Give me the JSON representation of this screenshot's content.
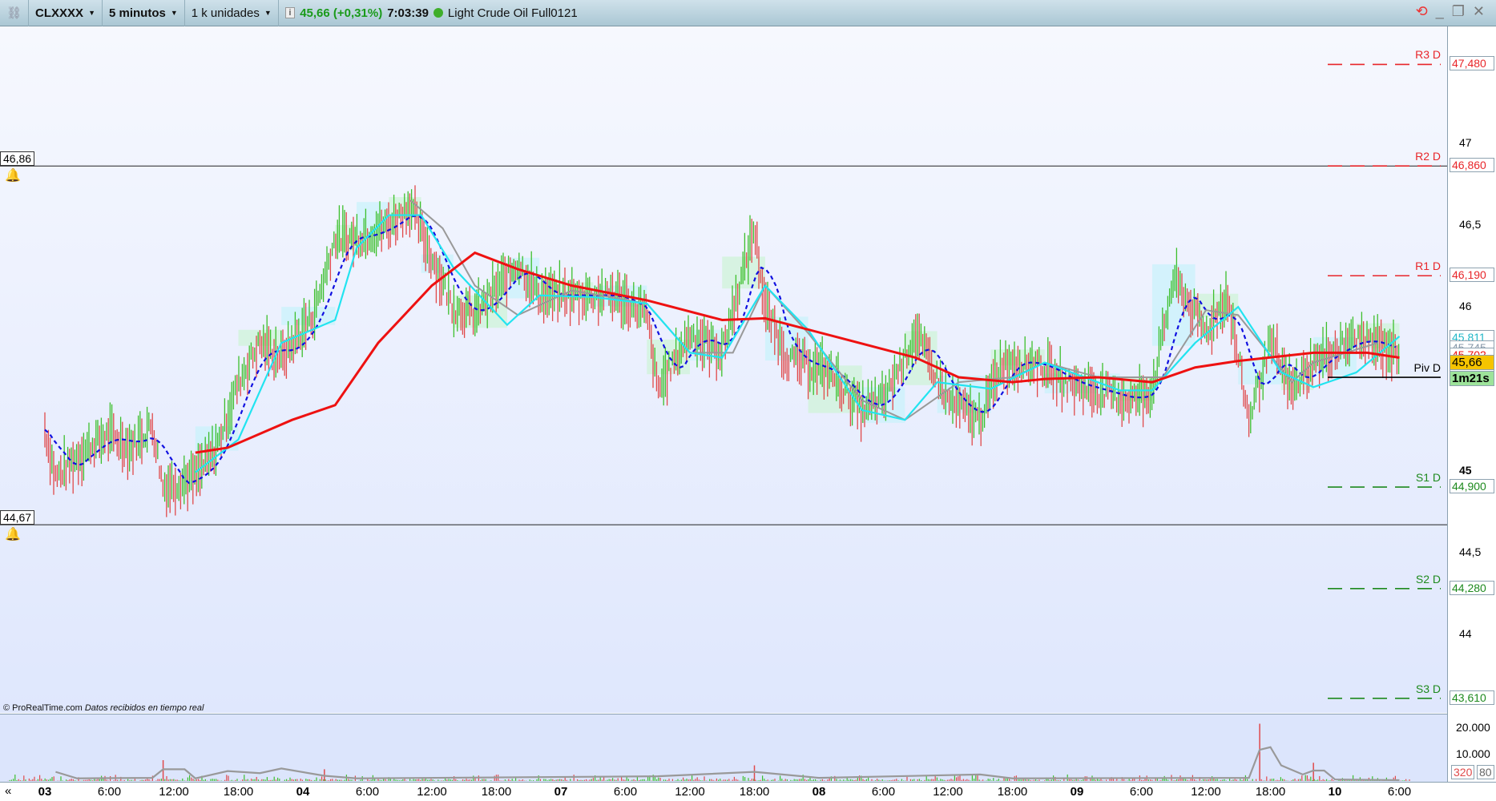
{
  "toolbar": {
    "symbol": "CLXXXX",
    "timeframe": "5 minutos",
    "units": "1 k unidades",
    "price_change": "45,66 (+0,31%)",
    "time": "7:03:39",
    "instrument": "Light Crude Oil Full0121",
    "info_icon": "info-icon",
    "refresh_icon": "refresh-arrows-icon"
  },
  "colors": {
    "up": "#3cbf2c",
    "down": "#e0494a",
    "ma_red": "#ee1111",
    "ma_cyan": "#22e4f0",
    "ma_blue": "#1010e0",
    "ma_gray": "#999999",
    "resistance": "#e8262a",
    "support": "#1e8a1e",
    "cloud_cyan": "#c8f2fb",
    "cloud_green": "#cdf3d6"
  },
  "footer": {
    "copyright": "© ProRealTime.com",
    "realtime": "Datos recibidos en tiempo real"
  },
  "hlines": [
    {
      "label": "46,86",
      "value": 46.86
    },
    {
      "label": "44,67",
      "value": 44.67
    }
  ],
  "levels": [
    {
      "name": "R3 D",
      "label": "47,480",
      "value": 47.48,
      "kind": "resistance"
    },
    {
      "name": "R2 D",
      "label": "46,860",
      "value": 46.86,
      "kind": "resistance"
    },
    {
      "name": "R1 D",
      "label": "46,190",
      "value": 46.19,
      "kind": "resistance"
    },
    {
      "name": "Piv D",
      "label": "45,570",
      "value": 45.57,
      "kind": "pivot"
    },
    {
      "name": "S1 D",
      "label": "44,900",
      "value": 44.9,
      "kind": "support"
    },
    {
      "name": "S2 D",
      "label": "44,280",
      "value": 44.28,
      "kind": "support"
    },
    {
      "name": "S3 D",
      "label": "43,610",
      "value": 43.61,
      "kind": "support"
    }
  ],
  "axis_ticks": [
    {
      "label": "47",
      "value": 47
    },
    {
      "label": "46,5",
      "value": 46.5
    },
    {
      "label": "46",
      "value": 46
    },
    {
      "label": "45",
      "value": 45,
      "bold": true
    },
    {
      "label": "44,5",
      "value": 44.5
    },
    {
      "label": "44",
      "value": 44
    }
  ],
  "indicator_labels": [
    {
      "label": "45,811",
      "value": 45.811,
      "color": "#22b8c8"
    },
    {
      "label": "45,745",
      "value": 45.745,
      "color": "#8899aa"
    },
    {
      "label": "45,702",
      "value": 45.702,
      "color": "#ee1111"
    }
  ],
  "last_price": {
    "label": "45,66",
    "value": 45.66
  },
  "countdown": "1m21s",
  "volume_axis": [
    {
      "label": "20.000",
      "value": 20000
    },
    {
      "label": "10.000",
      "value": 10000
    }
  ],
  "volume_last": {
    "a": "320",
    "b": "80"
  },
  "chart_data": {
    "type": "line",
    "time_labels": [
      "03",
      "6:00",
      "12:00",
      "18:00",
      "04",
      "6:00",
      "12:00",
      "18:00",
      "07",
      "6:00",
      "12:00",
      "18:00",
      "08",
      "6:00",
      "12:00",
      "18:00",
      "09",
      "6:00",
      "12:00",
      "18:00",
      "10",
      "6:00"
    ],
    "bold_labels": [
      "03",
      "04",
      "07",
      "08",
      "09",
      "10"
    ],
    "ylim": [
      43.45,
      47.7
    ],
    "series": [
      {
        "id": "price",
        "style": "bars",
        "points": [
          [
            "03 00:00",
            45.25
          ],
          [
            "03 01:00",
            44.96
          ],
          [
            "03 04:00",
            45.14
          ],
          [
            "03 06:00",
            45.22
          ],
          [
            "03 08:00",
            45.14
          ],
          [
            "03 10:00",
            45.28
          ],
          [
            "03 11:00",
            44.9
          ],
          [
            "03 14:00",
            44.96
          ],
          [
            "03 16:00",
            45.14
          ],
          [
            "03 18:00",
            45.54
          ],
          [
            "03 20:00",
            45.78
          ],
          [
            "03 22:00",
            45.69
          ],
          [
            "04 01:00",
            45.95
          ],
          [
            "04 03:00",
            46.42
          ],
          [
            "04 05:00",
            46.42
          ],
          [
            "04 08:00",
            46.5
          ],
          [
            "04 10:00",
            46.62
          ],
          [
            "04 12:00",
            46.3
          ],
          [
            "04 14:00",
            46.0
          ],
          [
            "04 16:00",
            45.95
          ],
          [
            "04 20:00",
            46.27
          ],
          [
            "04 22:00",
            46.07
          ],
          [
            "07 01:00",
            46.07
          ],
          [
            "07 05:00",
            46.07
          ],
          [
            "07 08:00",
            45.95
          ],
          [
            "07 09:00",
            45.49
          ],
          [
            "07 12:00",
            45.84
          ],
          [
            "07 15:00",
            45.72
          ],
          [
            "07 18:00",
            46.48
          ],
          [
            "07 19:00",
            46.0
          ],
          [
            "07 21:00",
            45.69
          ],
          [
            "08 01:00",
            45.6
          ],
          [
            "08 04:00",
            45.37
          ],
          [
            "08 06:00",
            45.43
          ],
          [
            "08 09:00",
            45.84
          ],
          [
            "08 12:00",
            45.43
          ],
          [
            "08 15:00",
            45.31
          ],
          [
            "08 17:00",
            45.66
          ],
          [
            "08 20:00",
            45.66
          ],
          [
            "08 23:00",
            45.54
          ],
          [
            "09 05:00",
            45.43
          ],
          [
            "09 07:00",
            45.49
          ],
          [
            "09 09:00",
            46.18
          ],
          [
            "09 12:00",
            45.84
          ],
          [
            "09 14:00",
            46.07
          ],
          [
            "09 16:00",
            45.31
          ],
          [
            "09 18:00",
            45.78
          ],
          [
            "09 20:00",
            45.49
          ],
          [
            "09 22:00",
            45.66
          ],
          [
            "10 02:00",
            45.81
          ],
          [
            "10 06:00",
            45.72
          ]
        ]
      },
      {
        "id": "ma_red",
        "style": "line",
        "points": [
          [
            "03 14:00",
            45.11
          ],
          [
            "03 17:00",
            45.14
          ],
          [
            "03 23:00",
            45.31
          ],
          [
            "04 03:00",
            45.4
          ],
          [
            "04 07:00",
            45.78
          ],
          [
            "04 12:00",
            46.13
          ],
          [
            "04 16:00",
            46.33
          ],
          [
            "04 20:00",
            46.23
          ],
          [
            "07 01:00",
            46.13
          ],
          [
            "07 08:00",
            46.04
          ],
          [
            "07 15:00",
            45.92
          ],
          [
            "07 19:00",
            45.93
          ],
          [
            "08 02:00",
            45.81
          ],
          [
            "08 09:00",
            45.69
          ],
          [
            "08 13:00",
            45.57
          ],
          [
            "08 18:00",
            45.54
          ],
          [
            "08 21:00",
            45.56
          ],
          [
            "09 02:00",
            45.57
          ],
          [
            "09 07:00",
            45.54
          ],
          [
            "09 11:00",
            45.63
          ],
          [
            "09 15:00",
            45.67
          ],
          [
            "09 22:00",
            45.72
          ],
          [
            "10 03:00",
            45.72
          ],
          [
            "10 06:00",
            45.69
          ]
        ]
      },
      {
        "id": "ma_cyan",
        "style": "line",
        "points": [
          [
            "03 14:00",
            44.99
          ],
          [
            "03 18:00",
            45.19
          ],
          [
            "03 22:00",
            45.78
          ],
          [
            "04 03:00",
            45.92
          ],
          [
            "04 05:00",
            46.36
          ],
          [
            "04 08:00",
            46.56
          ],
          [
            "04 11:00",
            46.56
          ],
          [
            "04 14:00",
            46.24
          ],
          [
            "04 19:00",
            45.89
          ],
          [
            "04 22:00",
            46.07
          ],
          [
            "07 03:00",
            46.06
          ],
          [
            "07 08:00",
            46.02
          ],
          [
            "07 12:00",
            45.72
          ],
          [
            "07 15:00",
            45.69
          ],
          [
            "07 19:00",
            46.13
          ],
          [
            "07 23:00",
            45.86
          ],
          [
            "08 04:00",
            45.37
          ],
          [
            "08 08:00",
            45.31
          ],
          [
            "08 11:00",
            45.54
          ],
          [
            "08 16:00",
            45.5
          ],
          [
            "08 21:00",
            45.66
          ],
          [
            "09 04:00",
            45.49
          ],
          [
            "09 07:00",
            45.49
          ],
          [
            "09 11:00",
            45.78
          ],
          [
            "09 15:00",
            46.0
          ],
          [
            "09 19:00",
            45.6
          ],
          [
            "09 22:00",
            45.51
          ],
          [
            "10 02:00",
            45.6
          ],
          [
            "10 06:00",
            45.82
          ]
        ]
      },
      {
        "id": "ma_gray",
        "style": "line",
        "points": [
          [
            "04 10:00",
            46.65
          ],
          [
            "04 13:00",
            46.48
          ],
          [
            "04 16:00",
            46.13
          ],
          [
            "04 20:00",
            45.95
          ],
          [
            "07 01:00",
            46.1
          ],
          [
            "07 08:00",
            46.02
          ],
          [
            "07 12:00",
            45.72
          ],
          [
            "07 16:00",
            45.72
          ],
          [
            "07 19:00",
            46.13
          ],
          [
            "07 23:00",
            45.84
          ],
          [
            "08 04:00",
            45.43
          ],
          [
            "08 08:00",
            45.31
          ],
          [
            "08 13:00",
            45.54
          ],
          [
            "08 18:00",
            45.57
          ],
          [
            "08 21:00",
            45.66
          ],
          [
            "09 02:00",
            45.57
          ],
          [
            "09 08:00",
            45.57
          ],
          [
            "09 12:00",
            45.98
          ],
          [
            "09 15:00",
            45.95
          ],
          [
            "09 20:00",
            45.54
          ],
          [
            "09 22:00",
            45.66
          ],
          [
            "10 04:00",
            45.78
          ]
        ]
      }
    ],
    "volume": {
      "ylim": [
        0,
        25000
      ],
      "avg_points": [
        [
          "03 01:00",
          3500
        ],
        [
          "03 03:00",
          1000
        ],
        [
          "03 10:00",
          1200
        ],
        [
          "03 11:00",
          4500
        ],
        [
          "03 13:00",
          4500
        ],
        [
          "03 14:00",
          1000
        ],
        [
          "03 17:00",
          3800
        ],
        [
          "03 20:00",
          3000
        ],
        [
          "03 22:00",
          4800
        ],
        [
          "04 02:00",
          2000
        ],
        [
          "04 05:00",
          1000
        ],
        [
          "07 09:00",
          1800
        ],
        [
          "07 18:00",
          3500
        ],
        [
          "08 00:00",
          1200
        ],
        [
          "08 15:00",
          2500
        ],
        [
          "08 18:00",
          1000
        ],
        [
          "09 16:00",
          1200
        ],
        [
          "09 17:00",
          12000
        ],
        [
          "09 18:00",
          13000
        ],
        [
          "09 19:00",
          6000
        ],
        [
          "09 21:00",
          2500
        ],
        [
          "09 22:00",
          4000
        ],
        [
          "09 23:00",
          4000
        ],
        [
          "10 00:00",
          600
        ],
        [
          "10 06:00",
          300
        ]
      ],
      "spikes": [
        [
          "03 11:00",
          8000
        ],
        [
          "04 02:00",
          4500
        ],
        [
          "07 18:00",
          6000
        ],
        [
          "09 17:00",
          22000
        ],
        [
          "09 22:00",
          7000
        ]
      ]
    }
  }
}
